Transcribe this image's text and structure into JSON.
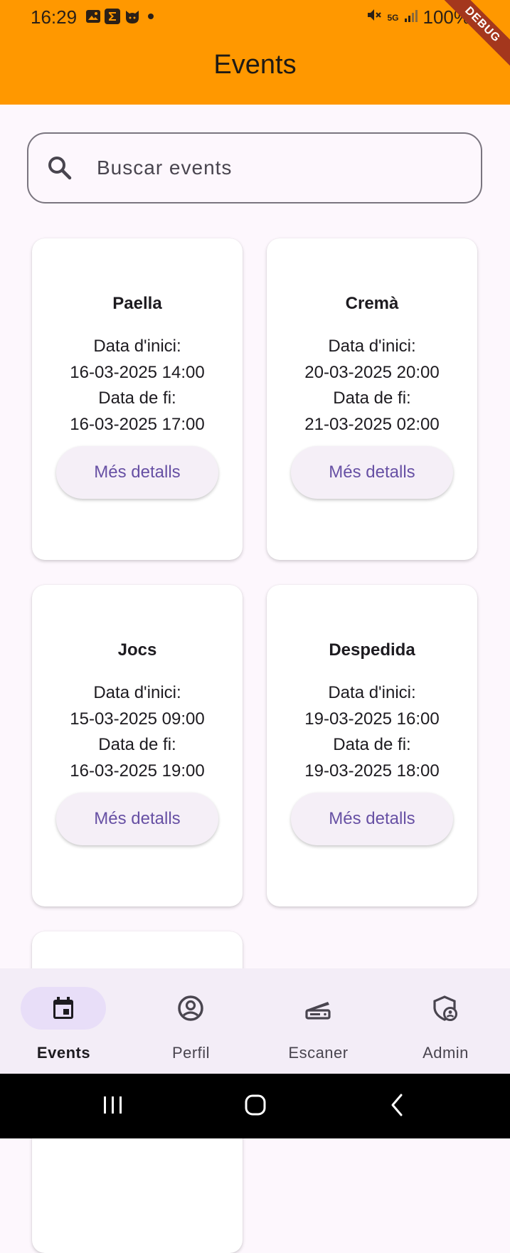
{
  "status_bar": {
    "time": "16:29",
    "battery": "100%",
    "network": "5G"
  },
  "app_bar": {
    "title": "Events",
    "debug_banner": "DEBUG",
    "color": "#ff9800"
  },
  "search": {
    "placeholder": "Buscar events",
    "value": ""
  },
  "events": [
    {
      "title": "Paella",
      "start_label": "Data d'inici:",
      "start": "16-03-2025 14:00",
      "end_label": "Data de fi:",
      "end": "16-03-2025 17:00",
      "button": "Més detalls"
    },
    {
      "title": "Cremà",
      "start_label": "Data d'inici:",
      "start": "20-03-2025 20:00",
      "end_label": "Data de fi:",
      "end": "21-03-2025 02:00",
      "button": "Més detalls"
    },
    {
      "title": "Jocs",
      "start_label": "Data d'inici:",
      "start": "15-03-2025 09:00",
      "end_label": "Data de fi:",
      "end": "16-03-2025 19:00",
      "button": "Més detalls"
    },
    {
      "title": "Despedida",
      "start_label": "Data d'inici:",
      "start": "19-03-2025 16:00",
      "end_label": "Data de fi:",
      "end": "19-03-2025 18:00",
      "button": "Més detalls"
    }
  ],
  "bottom_nav": {
    "items": [
      {
        "label": "Events",
        "icon": "calendar-icon",
        "active": true
      },
      {
        "label": "Perfil",
        "icon": "account-circle-icon",
        "active": false
      },
      {
        "label": "Escaner",
        "icon": "scanner-icon",
        "active": false
      },
      {
        "label": "Admin",
        "icon": "admin-shield-icon",
        "active": false
      }
    ]
  },
  "colors": {
    "accent": "#6750a4",
    "nav_active_pill": "#e8def8",
    "background": "#fdf7fd"
  }
}
